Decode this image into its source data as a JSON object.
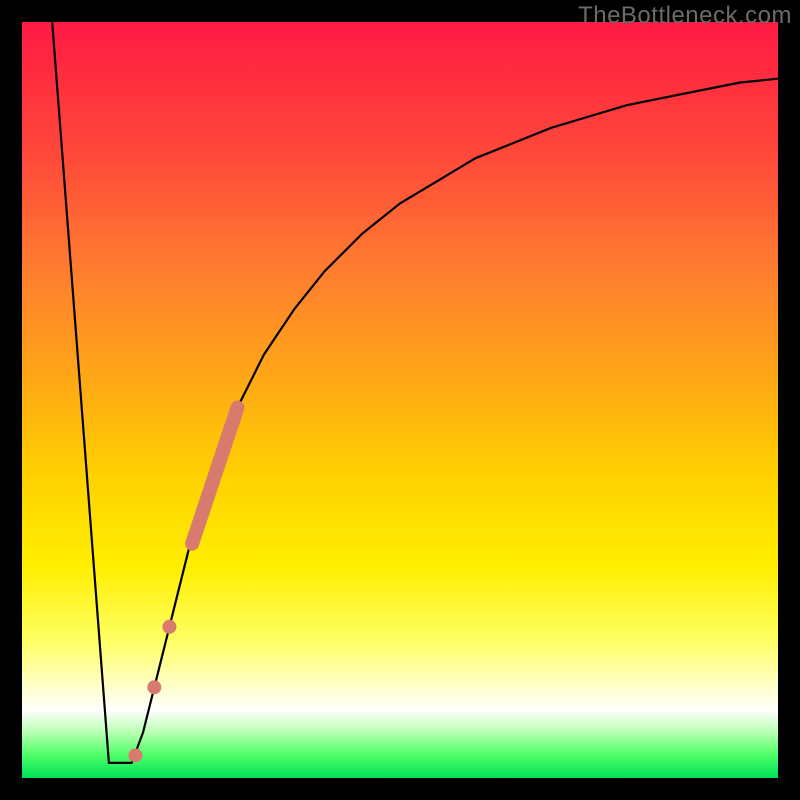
{
  "watermark": "TheBottleneck.com",
  "chart_data": {
    "type": "line",
    "title": "",
    "xlabel": "",
    "ylabel": "",
    "xlim": [
      0,
      100
    ],
    "ylim": [
      0,
      100
    ],
    "grid": false,
    "series": [
      {
        "name": "left-descent",
        "color": "#000000",
        "x": [
          4,
          11.5
        ],
        "values": [
          100,
          2
        ]
      },
      {
        "name": "valley-floor",
        "color": "#000000",
        "x": [
          11.5,
          14.5
        ],
        "values": [
          2,
          2
        ]
      },
      {
        "name": "right-ascent",
        "color": "#000000",
        "x": [
          14.5,
          16,
          18,
          20,
          22,
          25,
          28,
          32,
          36,
          40,
          45,
          50,
          55,
          60,
          65,
          70,
          75,
          80,
          85,
          90,
          95,
          100
        ],
        "values": [
          2,
          6,
          14,
          22,
          30,
          40,
          48,
          56,
          62,
          67,
          72,
          76,
          79,
          82,
          84,
          86,
          87.5,
          89,
          90,
          91,
          92,
          92.5
        ]
      }
    ],
    "markers": [
      {
        "name": "highlight-segment",
        "color": "#d97a6f",
        "type": "thick-line",
        "x": [
          22.5,
          28.5
        ],
        "values": [
          31,
          49
        ]
      },
      {
        "name": "marker-dot-1",
        "color": "#d97a6f",
        "type": "dot",
        "x": 19.5,
        "value": 20
      },
      {
        "name": "marker-dot-2",
        "color": "#d97a6f",
        "type": "dot",
        "x": 17.5,
        "value": 12
      },
      {
        "name": "marker-dot-3",
        "color": "#d97a6f",
        "type": "dot",
        "x": 15.0,
        "value": 3
      }
    ],
    "gradient_stops": [
      {
        "pos": 0,
        "color": "#ff1a45"
      },
      {
        "pos": 60,
        "color": "#ffd100"
      },
      {
        "pos": 91,
        "color": "#ffffff"
      },
      {
        "pos": 100,
        "color": "#00e05a"
      }
    ]
  }
}
